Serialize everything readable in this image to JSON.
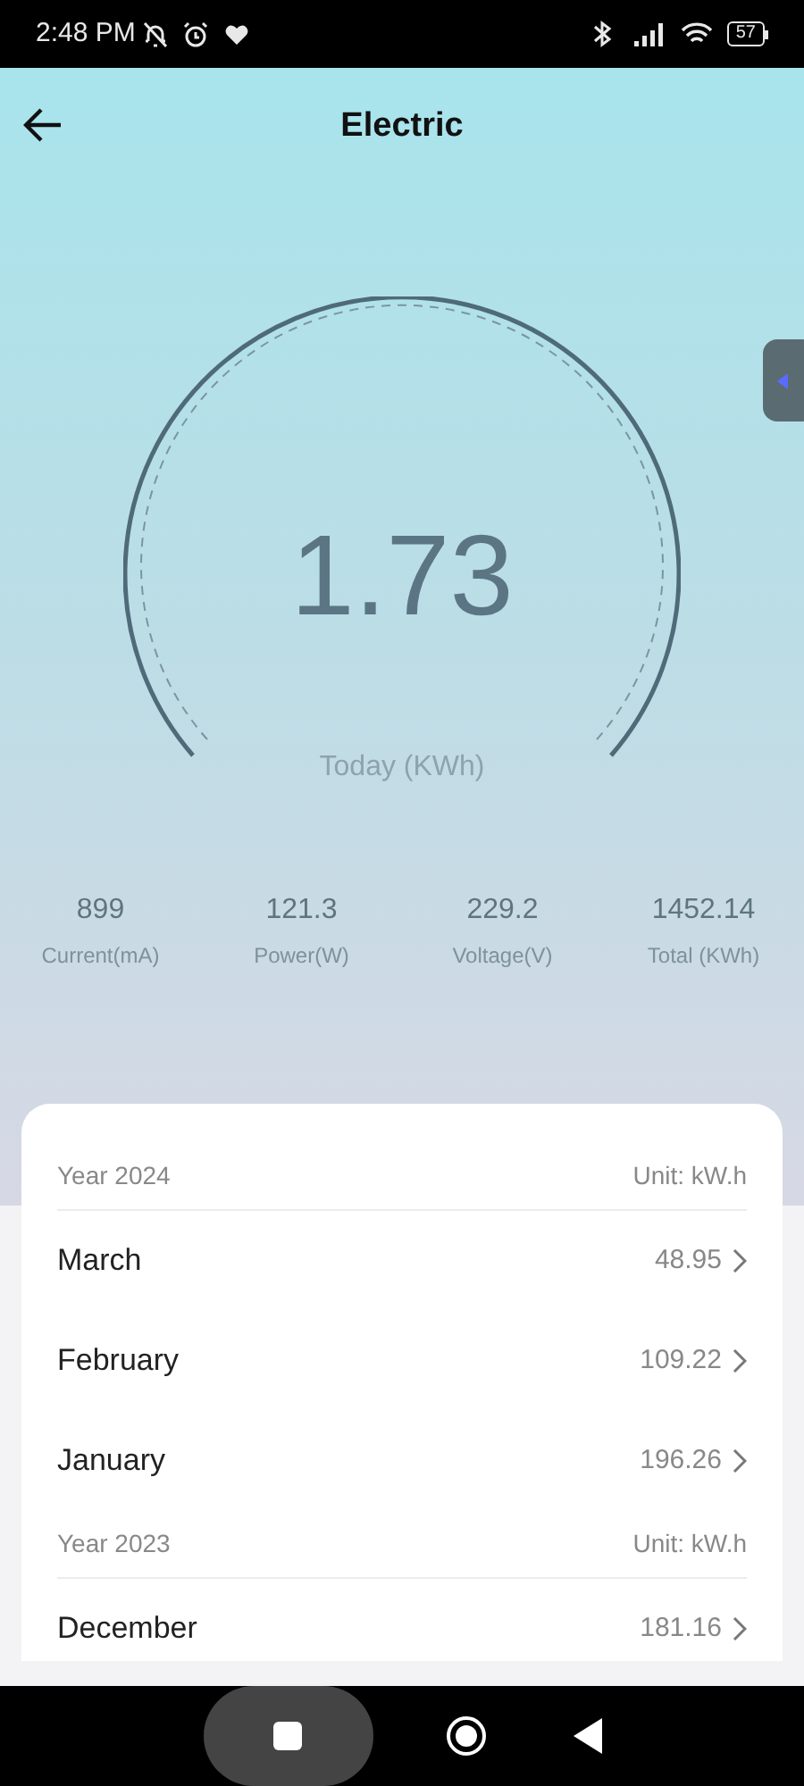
{
  "status_bar": {
    "time": "2:48 PM",
    "battery": "57"
  },
  "header": {
    "title": "Electric"
  },
  "gauge": {
    "value": "1.73",
    "caption": "Today (KWh)"
  },
  "stats": [
    {
      "value": "899",
      "label": "Current(mA)"
    },
    {
      "value": "121.3",
      "label": "Power(W)"
    },
    {
      "value": "229.2",
      "label": "Voltage(V)"
    },
    {
      "value": "1452.14",
      "label": "Total (KWh)"
    }
  ],
  "history": [
    {
      "year": "Year 2024",
      "unit": "Unit: kW.h",
      "months": [
        {
          "name": "March",
          "value": "48.95"
        },
        {
          "name": "February",
          "value": "109.22"
        },
        {
          "name": "January",
          "value": "196.26"
        }
      ]
    },
    {
      "year": "Year 2023",
      "unit": "Unit: kW.h",
      "months": [
        {
          "name": "December",
          "value": "181.16"
        }
      ]
    }
  ]
}
